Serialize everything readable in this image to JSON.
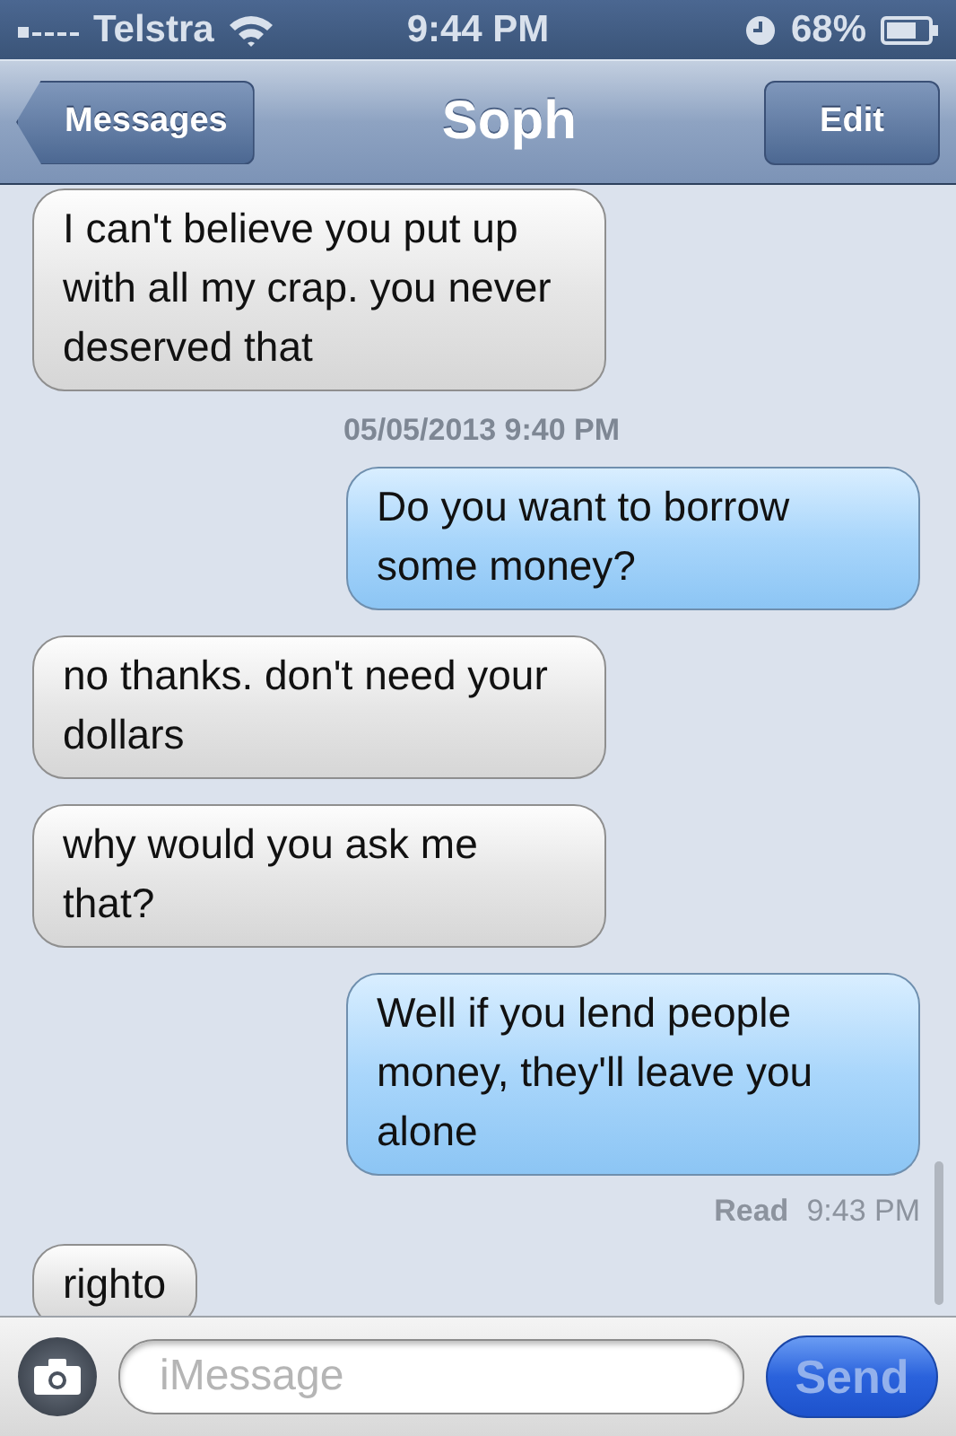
{
  "status_bar": {
    "carrier": "Telstra",
    "time": "9:44 PM",
    "battery": "68%"
  },
  "nav_bar": {
    "back": "Messages",
    "title": "Soph",
    "action": "Edit"
  },
  "messages": [
    {
      "kind": "received",
      "text": "I can't believe you put up with all my crap. you never deserved that"
    },
    {
      "kind": "timestamp",
      "text": "05/05/2013 9:40 PM"
    },
    {
      "kind": "sent",
      "text": "Do you want to borrow some money?"
    },
    {
      "kind": "received",
      "text": "no thanks. don't need your dollars"
    },
    {
      "kind": "received",
      "text": "why would you ask me that?"
    },
    {
      "kind": "sent",
      "text": "Well if you lend people money, they'll leave you alone"
    },
    {
      "kind": "receipt",
      "label": "Read",
      "text": "9:43 PM"
    },
    {
      "kind": "received",
      "text": "righto"
    }
  ],
  "composer": {
    "placeholder": "iMessage",
    "send": "Send",
    "send_disabled": true
  }
}
